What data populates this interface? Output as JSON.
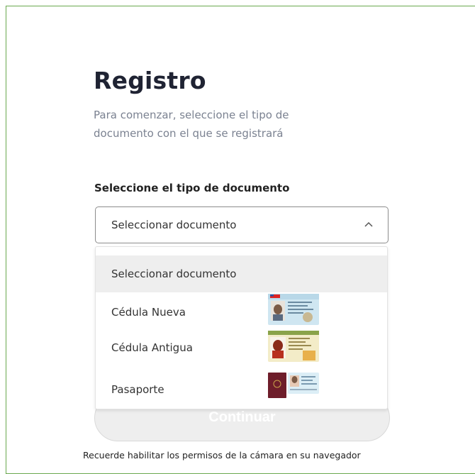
{
  "header": {
    "title": "Registro",
    "subtitle": "Para comenzar, seleccione el tipo de documento con el que se registrará"
  },
  "form": {
    "field_label": "Seleccione el tipo de documento",
    "select_value": "Seleccionar documento",
    "options": [
      {
        "label": "Seleccionar documento",
        "selected": true,
        "icon": null
      },
      {
        "label": "Cédula Nueva",
        "selected": false,
        "icon": "new-id-card-icon"
      },
      {
        "label": "Cédula Antigua",
        "selected": false,
        "icon": "old-id-card-icon"
      },
      {
        "label": "Pasaporte",
        "selected": false,
        "icon": "passport-icon"
      }
    ],
    "continue_label": "Continuar"
  },
  "footer": {
    "note": "Recuerde habilitar los permisos de la cámara en su navegador"
  },
  "colors": {
    "frame_border": "#6aa84f",
    "title": "#1f2333",
    "subtitle": "#7b8291",
    "button_bg": "#eeeeee",
    "selected_option_bg": "#eeeeee"
  }
}
